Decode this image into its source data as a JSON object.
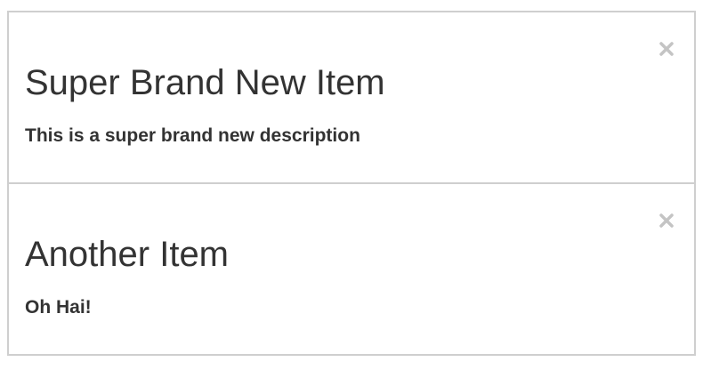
{
  "items": [
    {
      "title": "Super Brand New Item",
      "description": "This is a super brand new description",
      "close_icon": "close-icon"
    },
    {
      "title": "Another Item",
      "description": "Oh Hai!",
      "close_icon": "close-icon"
    }
  ],
  "colors": {
    "text": "#333333",
    "border": "#cfcfcf",
    "close_icon": "#c4c4c4",
    "background": "#ffffff"
  }
}
